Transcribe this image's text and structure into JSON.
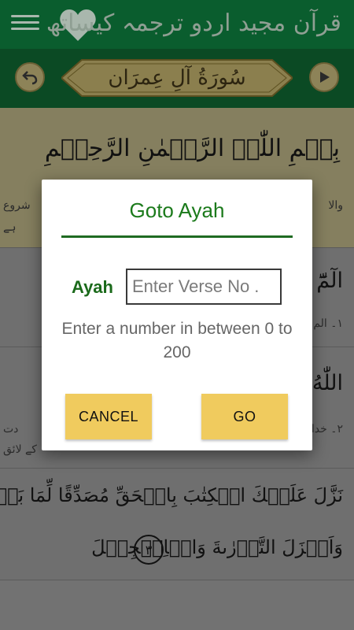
{
  "app_bar": {
    "title": "قرآن مجید اردو ترجمہ کیساتھ",
    "menu_icon": "hamburger-menu-icon",
    "favorite_icon": "heart-icon"
  },
  "surah_bar": {
    "surah_name": "سُورَةُ آلِ عِمرَان",
    "prev_icon": "arrow-back-icon",
    "next_icon": "play-forward-icon"
  },
  "content": {
    "bismillah": "بِسۡمِ اللّٰہِ الرَّحۡمٰنِ الرَّحِیۡمِ",
    "bismillah_translation_fragment": "شروع",
    "bismillah_translation_fragment_2": "والا",
    "bismillah_translation_fragment_3": "ہے",
    "ayah1_arabic_fragment": "الٓمّٓ",
    "ayah1_translation_fragment": "۱۔ الم",
    "ayah2_arabic_fragment": "اللّٰهُ لَآ",
    "ayah2_translation_fragment": "۲۔ خدا",
    "ayah2_translation_fragment_2": "دت",
    "ayah2_translation_fragment_3": "کے لائق",
    "ayah3_line1": "نَزَّلَ عَلَيۡكَ الۡكِتٰبَ بِالۡحَقِّ مُصَدِّقًا لِّمَا بَيۡنَ يَدَيۡهِ",
    "ayah3_line2": "وَاَنۡزَلَ التَّوۡرٰىةَ وَالۡاِنۡجِيۡلَ",
    "ayah3_marker": "٣"
  },
  "dialog": {
    "title": "Goto Ayah",
    "field_label": "Ayah",
    "input_placeholder": "Enter Verse No .",
    "input_value": "",
    "hint": "Enter a number in between 0 to 200",
    "cancel_label": "CANCEL",
    "go_label": "GO"
  },
  "colors": {
    "app_bar": "#0a5d2e",
    "title_green": "#1b7a1b",
    "button_yellow": "#f0cb5e"
  }
}
